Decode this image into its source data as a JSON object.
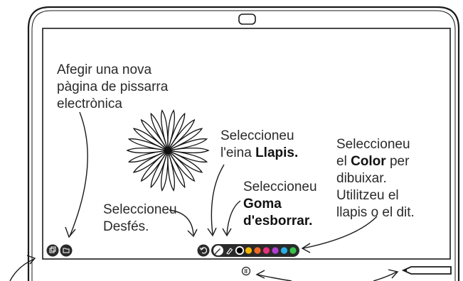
{
  "annotations": {
    "add_page": [
      "Afegir una nova",
      "pàgina de pissarra",
      "electrònica"
    ],
    "pencil": {
      "line1": "Seleccioneu",
      "line2_prefix": "l'eina ",
      "line2_bold": "Llapis."
    },
    "eraser": {
      "line1": "Seleccioneu",
      "line2_bold": "Goma",
      "line3_bold": "d'esborrar."
    },
    "undo": [
      "Seleccioneu",
      "Desfés."
    ],
    "color": {
      "line1": "Seleccioneu",
      "line2_prefix": "el ",
      "line2_bold": "Color",
      "line2_suffix": " per",
      "line3": "dibuixar.",
      "line4": "Utilitzeu el",
      "line5": "llapis o el dit."
    }
  },
  "toolbar": {
    "colors": [
      "#000000",
      "#f5b800",
      "#f06a26",
      "#ea2f7a",
      "#b13fd1",
      "#2ab0e8",
      "#39c24a"
    ],
    "selected_color": "#000000"
  },
  "icons": {
    "left_tools": [
      "new-page-icon",
      "folder-icon"
    ],
    "undo": "undo-icon",
    "pencil": "pencil-icon",
    "eraser": "eraser-icon",
    "home": "home-icon",
    "camera": "camera-icon",
    "stylus": "stylus-icon"
  },
  "colors": {
    "frame": "#1a1a1a",
    "toolbar_bg": "#2a2a2a",
    "text": "#2a2a2a"
  }
}
